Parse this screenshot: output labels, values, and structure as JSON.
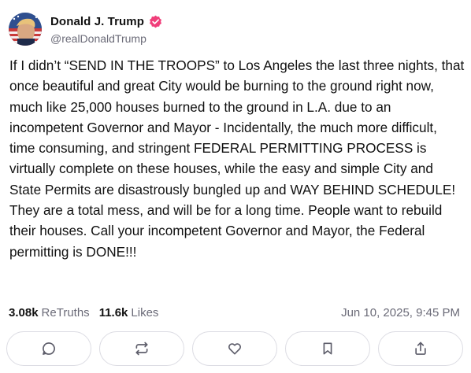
{
  "author": {
    "display_name": "Donald J. Trump",
    "handle": "@realDonaldTrump",
    "verified": true,
    "verified_color": "#f03e7a",
    "avatar": "flag-avatar"
  },
  "post": {
    "text": "If I didn’t “SEND IN THE TROOPS” to Los Angeles the last three nights, that once beautiful and great City would be burning to the ground right now, much like 25,000 houses burned to the ground in L.A. due to an incompetent Governor and Mayor - Incidentally, the much more difficult, time consuming, and stringent FEDERAL PERMITTING PROCESS is virtually complete on these houses, while the easy and simple City and State Permits are disastrously bungled up and WAY BEHIND SCHEDULE! They are a total mess, and will be for a long time. People want to rebuild their houses. Call your incompetent Governor and Mayor, the Federal permitting is DONE!!!"
  },
  "stats": {
    "retruths_count": "3.08k",
    "retruths_label": "ReTruths",
    "likes_count": "11.6k",
    "likes_label": "Likes",
    "timestamp": "Jun 10, 2025, 9:45 PM"
  },
  "actions": [
    {
      "icon": "reply-icon"
    },
    {
      "icon": "retruth-icon"
    },
    {
      "icon": "heart-icon"
    },
    {
      "icon": "bookmark-icon"
    },
    {
      "icon": "share-icon"
    }
  ],
  "colors": {
    "text": "#111111",
    "muted": "#6b6b78",
    "border": "#dcdce3"
  }
}
